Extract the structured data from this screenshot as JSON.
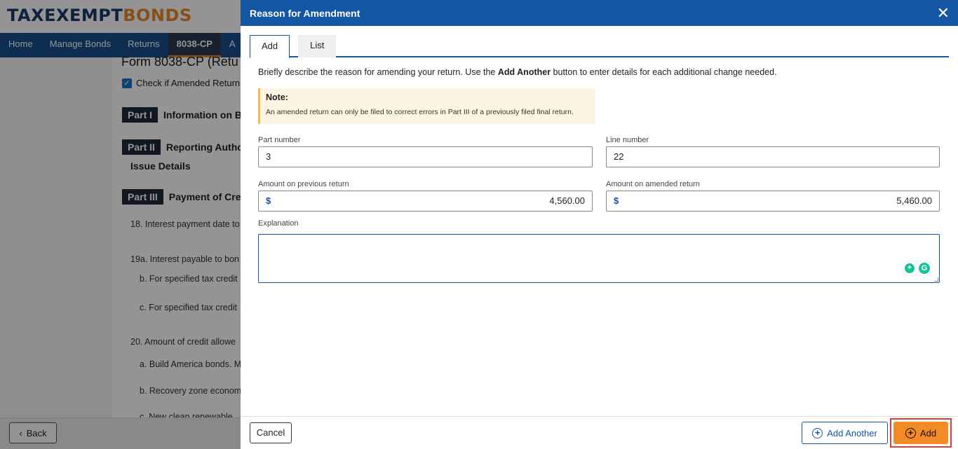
{
  "background": {
    "logo": {
      "part1": "TAXEXEMPT",
      "part2": "BONDS"
    },
    "nav": [
      "Home",
      "Manage Bonds",
      "Returns",
      "8038-CP",
      "A"
    ],
    "nav_active_index": 3,
    "form_title": "Form 8038-CP (Retu",
    "amended_check_label": "Check if Amended Return (",
    "parts": [
      {
        "badge": "Part I",
        "title": "Information on B"
      },
      {
        "badge": "Part II",
        "title": "Reporting Autho"
      },
      {
        "badge": "Part III",
        "title": "Payment of Cred"
      }
    ],
    "issue_details": "Issue Details",
    "lines": [
      "18. Interest payment date to",
      "19a. Interest payable to bon",
      "b. For specified tax credit",
      "c. For specified tax credit",
      "20. Amount of credit allowe",
      "a. Build America bonds. M",
      "b. Recovery zone econom",
      "c. New clean renewable"
    ],
    "back_label": "Back"
  },
  "modal": {
    "title": "Reason for Amendment",
    "tabs": [
      {
        "label": "Add",
        "active": true
      },
      {
        "label": "List",
        "active": false
      }
    ],
    "desc_prefix": "Briefly describe the reason for amending your return. Use the ",
    "desc_bold": "Add Another",
    "desc_suffix": " button to enter details for each additional change needed.",
    "note_title": "Note:",
    "note_text": "An amended return can only be filed to correct errors in Part III of a previously filed final return.",
    "fields": {
      "part_number": {
        "label": "Part number",
        "value": "3"
      },
      "line_number": {
        "label": "Line number",
        "value": "22"
      },
      "amount_previous": {
        "label": "Amount on previous return",
        "currency": "$",
        "value": "4,560.00"
      },
      "amount_amended": {
        "label": "Amount on amended return",
        "currency": "$",
        "value": "5,460.00"
      },
      "explanation": {
        "label": "Explanation",
        "value": ""
      }
    },
    "footer": {
      "cancel_label": "Cancel",
      "add_another_label": "Add Another",
      "add_label": "Add"
    }
  },
  "colors": {
    "header_blue": "#1356a3",
    "accent_orange": "#f28a26",
    "highlight_red": "#e23b3b",
    "note_bg": "#fdf4e3",
    "note_border": "#f2b950"
  },
  "icons": [
    "close-icon",
    "add-circle-icon",
    "chevron-left-icon",
    "grammarly-icon",
    "checkmark-icon"
  ]
}
